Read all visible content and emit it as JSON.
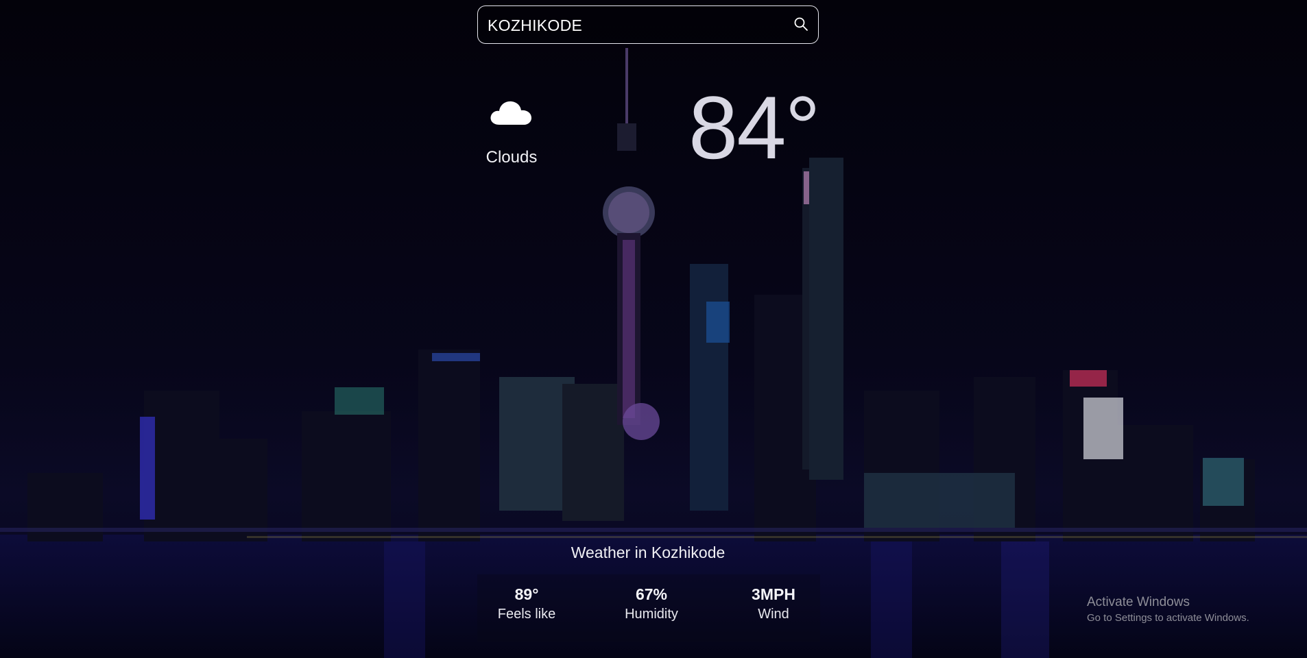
{
  "search": {
    "value": "KOZHIKODE",
    "icon": "search-icon"
  },
  "current": {
    "icon": "cloud-icon",
    "condition": "Clouds",
    "temperature": "84°"
  },
  "location_title": "Weather in Kozhikode",
  "stats": {
    "feels_like": {
      "value": "89°",
      "label": "Feels like"
    },
    "humidity": {
      "value": "67%",
      "label": "Humidity"
    },
    "wind": {
      "value": "3MPH",
      "label": "Wind"
    }
  },
  "watermark": {
    "title": "Activate Windows",
    "subtitle": "Go to Settings to activate Windows."
  },
  "colors": {
    "background": "#04030c",
    "text": "#ffffff",
    "temperature": "#d9d8e4"
  }
}
